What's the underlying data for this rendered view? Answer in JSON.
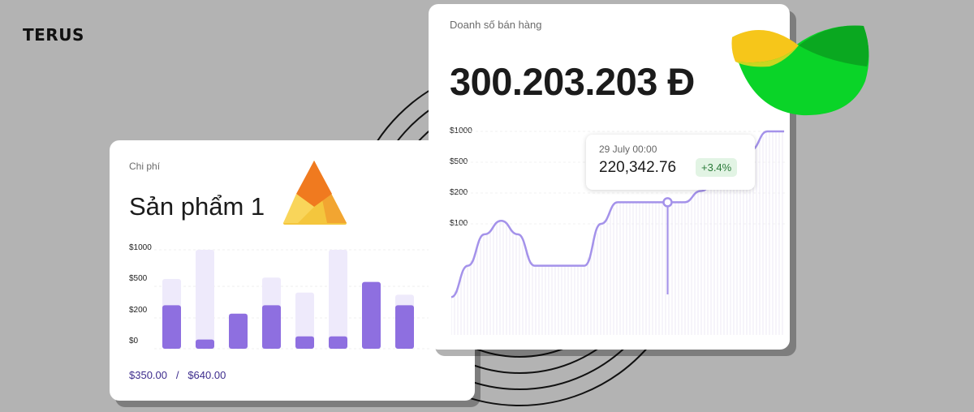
{
  "brand": "TERUS",
  "expense_card": {
    "label": "Chi phí",
    "title": "Sản phẩm 1",
    "logo": "orange-triangle-logo",
    "total_a": "$350.00",
    "separator": "/",
    "total_b": "$640.00"
  },
  "sales_card": {
    "label": "Doanh số bán hàng",
    "amount": "300.203.203 Đ",
    "logo": "green-yellow-leaf-logo",
    "tooltip": {
      "date": "29 July 00:00",
      "value": "220,342.76",
      "change": "+3.4%"
    }
  },
  "colors": {
    "bar_fill": "#8e6fe0",
    "bar_track": "#eeeafb",
    "line": "#a492ea",
    "badge_bg": "#e2f4e4",
    "badge_text": "#2b7b3a",
    "background": "#b3b3b3"
  },
  "chart_data": [
    {
      "type": "bar",
      "ytick_labels": [
        "$1000",
        "$500",
        "$200",
        "$0"
      ],
      "ytick_values": [
        1000,
        500,
        200,
        0
      ],
      "series": [
        {
          "values": [
            320,
            60,
            240,
            320,
            80,
            80,
            560,
            320
          ]
        },
        {
          "values": [
            600,
            1000,
            0,
            620,
            440,
            1000,
            0,
            420
          ]
        }
      ]
    },
    {
      "type": "area",
      "ytick_labels": [
        "$1000",
        "$500",
        "$200",
        "$100"
      ],
      "ytick_values": [
        1000,
        500,
        200,
        100
      ],
      "x": [
        0,
        1,
        2,
        3,
        4,
        5,
        6,
        7,
        8,
        9,
        10,
        11,
        12,
        13,
        14,
        15,
        16,
        17,
        18,
        19,
        20
      ],
      "values": [
        30,
        60,
        90,
        110,
        90,
        60,
        60,
        60,
        60,
        100,
        170,
        170,
        170,
        170,
        170,
        220,
        330,
        500,
        700,
        1000,
        1000
      ],
      "highlight_index": 13
    }
  ]
}
